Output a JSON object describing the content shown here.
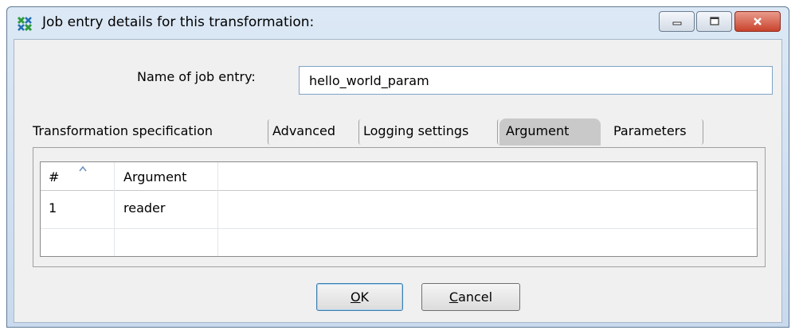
{
  "window": {
    "title": "Job entry details for this transformation:",
    "icon": "pentaho-transformation-icon"
  },
  "form": {
    "name_label": "Name of job entry:",
    "name_value": "hello_world_param"
  },
  "tabs": [
    {
      "label": "Transformation specification",
      "active": false
    },
    {
      "label": "Advanced",
      "active": false
    },
    {
      "label": "Logging settings",
      "active": false
    },
    {
      "label": "Argument",
      "active": true
    },
    {
      "label": "Parameters",
      "active": false
    }
  ],
  "grid": {
    "columns": [
      "#",
      "Argument"
    ],
    "rows": [
      {
        "num": "1",
        "argument": "reader"
      }
    ]
  },
  "buttons": {
    "ok_mnemonic": "O",
    "ok_rest": "K",
    "cancel_mnemonic": "C",
    "cancel_rest": "ancel"
  },
  "colors": {
    "titlebar": "#c9daee",
    "client": "#f0f0f0",
    "close_button": "#c9432c",
    "active_tab": "#c9c9c9"
  }
}
